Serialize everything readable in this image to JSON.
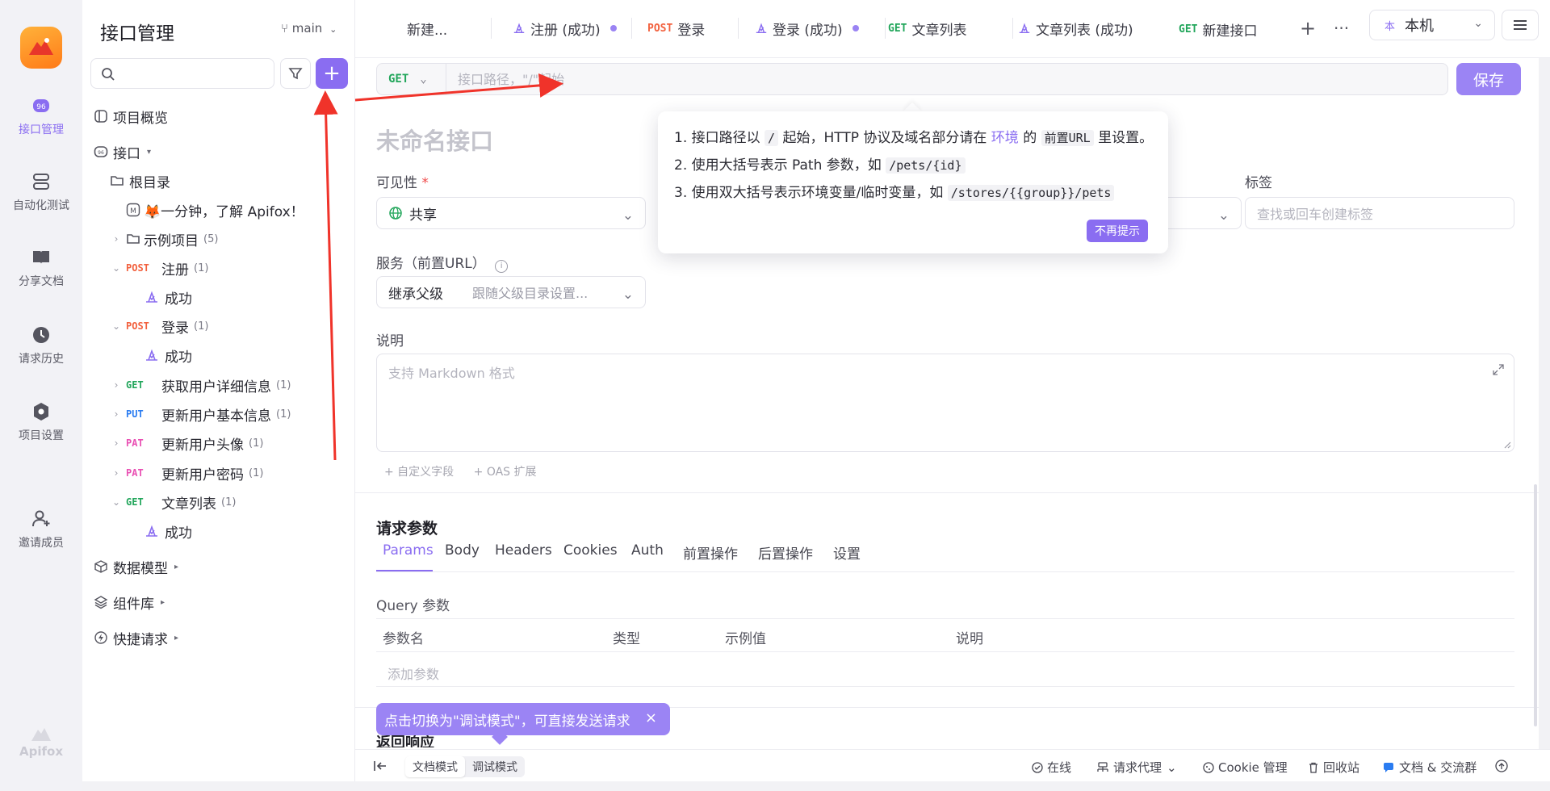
{
  "rail": {
    "items": [
      {
        "label": "接口管理",
        "icon": "api-icon",
        "active": true
      },
      {
        "label": "自动化测试",
        "icon": "automation-icon"
      },
      {
        "label": "分享文档",
        "icon": "book-icon"
      },
      {
        "label": "请求历史",
        "icon": "clock-icon"
      },
      {
        "label": "项目设置",
        "icon": "settings-icon"
      },
      {
        "label": "邀请成员",
        "icon": "user-plus-icon"
      }
    ],
    "footer": "Apifox"
  },
  "sidebar": {
    "title": "接口管理",
    "branch": "main",
    "search_placeholder": "",
    "tree": [
      {
        "label": "项目概览",
        "icon": "overview-icon"
      },
      {
        "label": "接口",
        "icon": "api-icon"
      },
      {
        "label": "根目录",
        "icon": "folder-root-icon"
      },
      {
        "label": "🦊一分钟，了解 Apifox！",
        "icon": "markdown-icon"
      },
      {
        "label": "示例项目",
        "count": "(5)"
      },
      {
        "method": "POST",
        "label": "注册",
        "count": "(1)"
      },
      {
        "label": "成功"
      },
      {
        "method": "POST",
        "label": "登录",
        "count": "(1)"
      },
      {
        "label": "成功"
      },
      {
        "method": "GET",
        "label": "获取用户详细信息",
        "count": "(1)"
      },
      {
        "method": "PUT",
        "label": "更新用户基本信息",
        "count": "(1)"
      },
      {
        "method": "PAT",
        "label": "更新用户头像",
        "count": "(1)"
      },
      {
        "method": "PAT",
        "label": "更新用户密码",
        "count": "(1)"
      },
      {
        "method": "GET",
        "label": "文章列表",
        "count": "(1)"
      },
      {
        "label": "成功"
      },
      {
        "label": "数据模型"
      },
      {
        "label": "组件库"
      },
      {
        "label": "快捷请求"
      }
    ]
  },
  "tabs": [
    {
      "label": "新建...",
      "method": ""
    },
    {
      "label": "注册 (成功)",
      "method": ""
    },
    {
      "label": "登录",
      "method": "POST"
    },
    {
      "label": "登录 (成功)",
      "method": ""
    },
    {
      "label": "文章列表",
      "method": "GET"
    },
    {
      "label": "文章列表 (成功)",
      "method": ""
    },
    {
      "label": "新建接口",
      "method": "GET"
    }
  ],
  "env": {
    "label": "本机",
    "badge": "本"
  },
  "editor": {
    "method": "GET",
    "url_placeholder": "接口路径，\"/\"起始",
    "save_label": "保存",
    "name_placeholder": "未命名接口",
    "visibility_label": "可见性",
    "visibility_value": "共享",
    "tags_label": "标签",
    "tags_placeholder": "查找或回车创建标签",
    "service_label": "服务（前置URL）",
    "service_value": "继承父级",
    "service_hint": "跟随父级目录设置...",
    "desc_label": "说明",
    "desc_placeholder": "支持 Markdown 格式",
    "custom_field": "+ 自定义字段",
    "oas_ext": "+ OAS 扩展"
  },
  "request_params": {
    "title": "请求参数",
    "tabs": [
      "Params",
      "Body",
      "Headers",
      "Cookies",
      "Auth",
      "前置操作",
      "后置操作",
      "设置"
    ],
    "query_label": "Query 参数",
    "columns": [
      "参数名",
      "类型",
      "示例值",
      "说明"
    ],
    "add_param": "添加参数"
  },
  "tip": {
    "l1_a": "1. 接口路径以",
    "l1_code": "/",
    "l1_b": "起始，HTTP 协议及域名部分请在",
    "l1_link": "环境",
    "l1_c": "的",
    "l1_code2": "前置URL",
    "l1_d": "里设置。",
    "l2_a": "2. 使用大括号表示 Path 参数，如",
    "l2_code": "/pets/{id}",
    "l3_a": "3. 使用双大括号表示环境变量/临时变量，如",
    "l3_code": "/stores/{{group}}/pets",
    "dismiss": "不再提示"
  },
  "toast": {
    "text": "点击切换为\"调试模式\"，可直接发送请求",
    "close": "×"
  },
  "peek_title": "返回响应",
  "statusbar": {
    "doc_mode": "文档模式",
    "debug_mode": "调试模式",
    "online": "在线",
    "proxy": "请求代理",
    "cookie": "Cookie 管理",
    "trash": "回收站",
    "community": "文档 & 交流群"
  },
  "colors": {
    "accent": "#8a6df1",
    "post": "#f2603d",
    "get": "#22a65b",
    "put": "#2a7cf1",
    "patch": "#e94fb3",
    "annotation": "#f0332a"
  }
}
